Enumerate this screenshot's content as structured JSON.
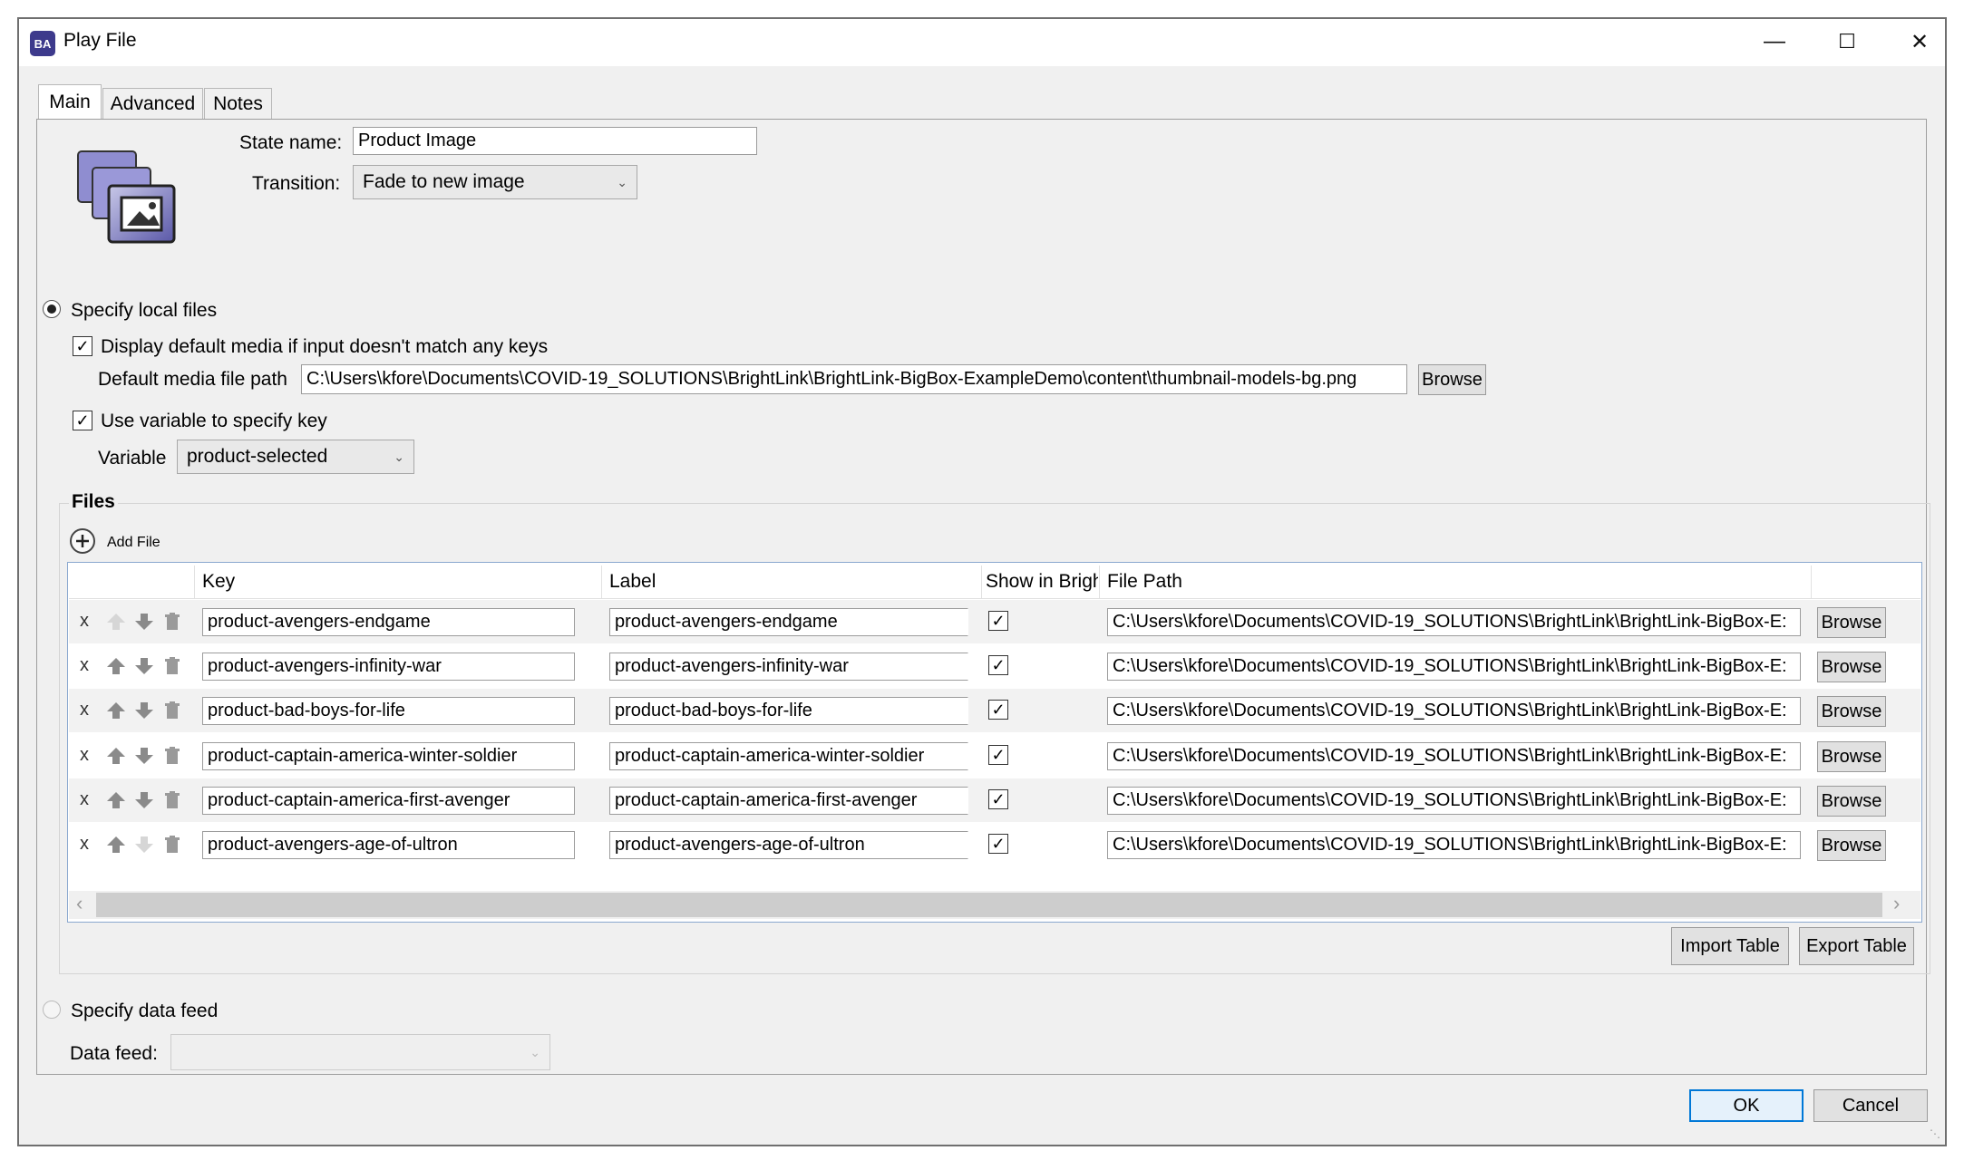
{
  "window": {
    "title": "Play File",
    "app_icon": "BA",
    "minimize": "—",
    "maximize": "☐",
    "close": "✕"
  },
  "tabs": [
    {
      "label": "Main",
      "active": true
    },
    {
      "label": "Advanced"
    },
    {
      "label": "Notes"
    }
  ],
  "state": {
    "name_label": "State name:",
    "name_value": "Product Image",
    "transition_label": "Transition:",
    "transition_value": "Fade to new image"
  },
  "local_files": {
    "radio_label": "Specify local files",
    "display_default_label": "Display default media if input doesn't match any keys",
    "default_path_label": "Default media file path",
    "default_path_value": "C:\\Users\\kfore\\Documents\\COVID-19_SOLUTIONS\\BrightLink\\BrightLink-BigBox-ExampleDemo\\content\\thumbnail-models-bg.png",
    "browse_label": "Browse",
    "use_variable_label": "Use variable to specify key",
    "variable_label": "Variable",
    "variable_value": "product-selected"
  },
  "files": {
    "group_label": "Files",
    "add_file_label": "Add File",
    "columns": {
      "key": "Key",
      "label": "Label",
      "show": "Show in Brigh",
      "path": "File Path"
    },
    "rows": [
      {
        "x": "x",
        "key": "product-avengers-endgame",
        "label": "product-avengers-endgame",
        "show": "✓",
        "path": "C:\\Users\\kfore\\Documents\\COVID-19_SOLUTIONS\\BrightLink\\BrightLink-BigBox-E:",
        "browse": "Browse"
      },
      {
        "x": "x",
        "key": "product-avengers-infinity-war",
        "label": "product-avengers-infinity-war",
        "show": "✓",
        "path": "C:\\Users\\kfore\\Documents\\COVID-19_SOLUTIONS\\BrightLink\\BrightLink-BigBox-E:",
        "browse": "Browse"
      },
      {
        "x": "x",
        "key": "product-bad-boys-for-life",
        "label": "product-bad-boys-for-life",
        "show": "✓",
        "path": "C:\\Users\\kfore\\Documents\\COVID-19_SOLUTIONS\\BrightLink\\BrightLink-BigBox-E:",
        "browse": "Browse"
      },
      {
        "x": "x",
        "key": "product-captain-america-winter-soldier",
        "label": "product-captain-america-winter-soldier",
        "show": "✓",
        "path": "C:\\Users\\kfore\\Documents\\COVID-19_SOLUTIONS\\BrightLink\\BrightLink-BigBox-E:",
        "browse": "Browse"
      },
      {
        "x": "x",
        "key": "product-captain-america-first-avenger",
        "label": "product-captain-america-first-avenger",
        "show": "✓",
        "path": "C:\\Users\\kfore\\Documents\\COVID-19_SOLUTIONS\\BrightLink\\BrightLink-BigBox-E:",
        "browse": "Browse"
      },
      {
        "x": "x",
        "key": "product-avengers-age-of-ultron",
        "label": "product-avengers-age-of-ultron",
        "show": "✓",
        "path": "C:\\Users\\kfore\\Documents\\COVID-19_SOLUTIONS\\BrightLink\\BrightLink-BigBox-E:",
        "browse": "Browse"
      }
    ],
    "scroll_left": "‹",
    "scroll_right": "›",
    "import_label": "Import Table",
    "export_label": "Export Table"
  },
  "data_feed": {
    "radio_label": "Specify data feed",
    "label": "Data feed:",
    "value": ""
  },
  "footer": {
    "ok_label": "OK",
    "cancel_label": "Cancel"
  },
  "icons": {
    "check": "check-icon",
    "dropdown": "chevron-down-icon",
    "up": "arrow-up-icon",
    "down": "arrow-down-icon",
    "delete": "trash-icon"
  }
}
